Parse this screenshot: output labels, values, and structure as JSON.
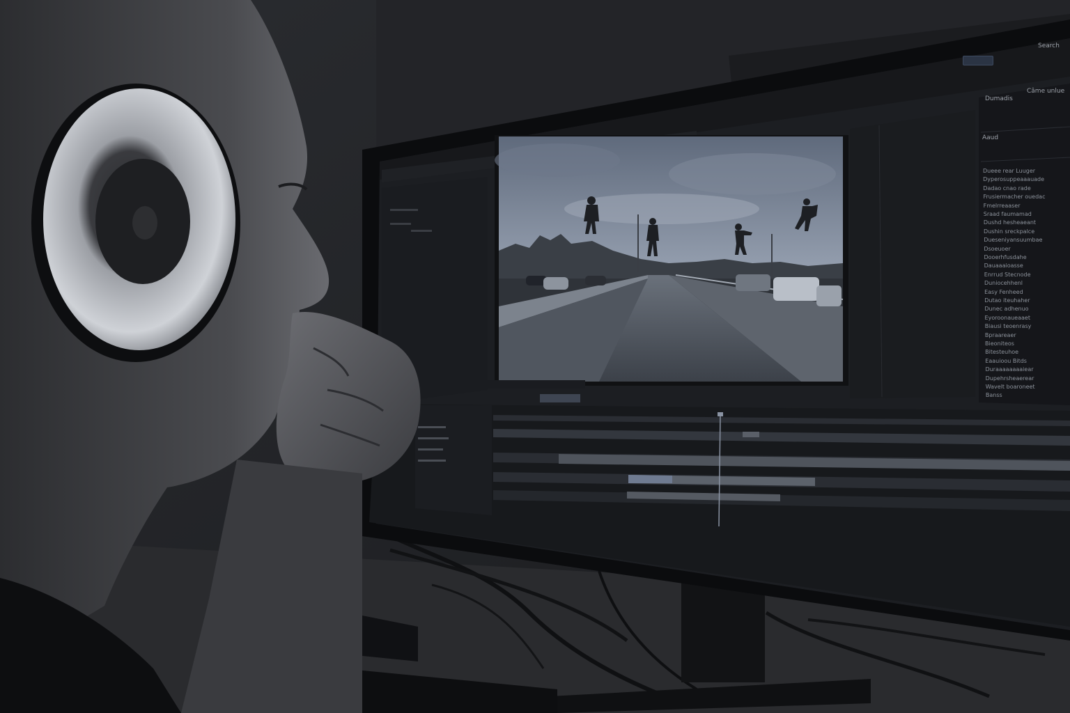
{
  "top_bar": {
    "button_label": "",
    "search_label": "Search"
  },
  "right_panel": {
    "header_left": "Dumadis",
    "header_right": "Câme unlue",
    "section_label": "Aaud",
    "items": [
      "Dueee rear Luuger",
      "Dyperosuppeaaauade",
      "Dadao cnao rade",
      "Frusiermacher ouedac",
      "Fmelrreaaser",
      "Sraad faumamad",
      "Dushd hesheaeant",
      "Dushin sreckpalce",
      "Dueseniyansuumbae",
      "Dsoeuoer",
      "Dooerhfusdahe",
      "Dauaaaioasse",
      "Enrrud Stecnode",
      "Duniocehhenl",
      "Easy Fenheed",
      "Dutao iteuhaher",
      "Dunec adhenuo",
      "Eyoroonaueaaet",
      "Biausi teoenrasy",
      "Bpraareaer",
      "Bieoniteos",
      "Bitesteuhoe",
      "Eaauioou Bitds",
      "Duraaaaaaaaiear",
      "Dupehrsheaerear",
      "Wavelt boaroneet",
      "Banss"
    ]
  },
  "colors": {
    "monitor_frame": "#0b0c0e",
    "ui_background": "#1c1e22",
    "sky": "#8793a6",
    "road": "#4d535d",
    "accent": "#3d4a60"
  },
  "icons": [
    "headphones-icon",
    "playhead-icon",
    "play-icon"
  ]
}
